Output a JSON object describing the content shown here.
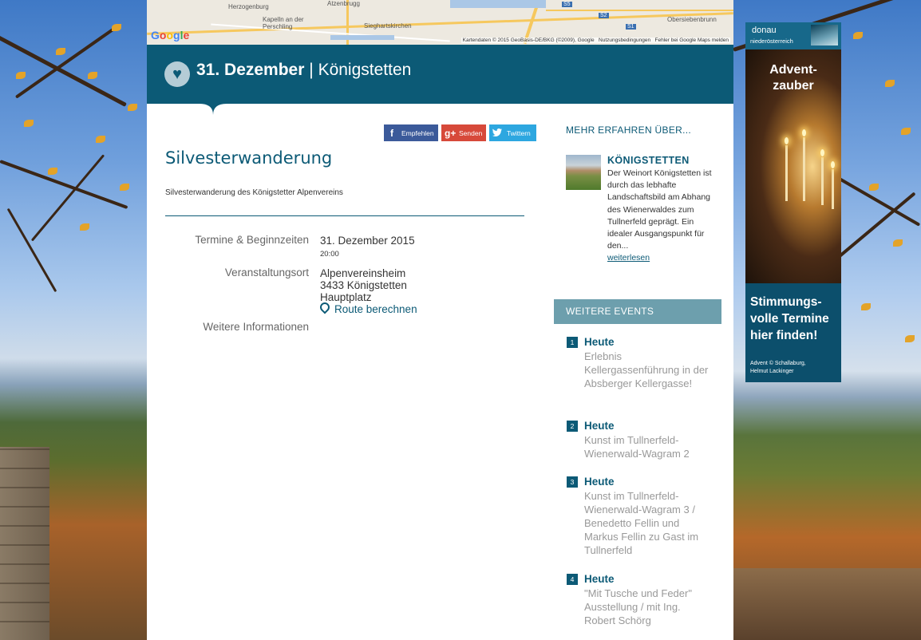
{
  "map": {
    "towns": [
      "Herzogenburg",
      "Atzenbrugg",
      "Kapelln an der Perschling",
      "Sieghartskirchen",
      "Obersiebenbrunn"
    ],
    "road_shields": [
      "S5",
      "S2",
      "S1"
    ],
    "logo": "Google",
    "attribution": "Kartendaten © 2015 GeoBasis-DE/BKG (©2009), Google",
    "terms": "Nutzungsbedingungen",
    "report": "Fehler bei Google Maps melden"
  },
  "header": {
    "date": "31. Dezember",
    "separator": "|",
    "place": "Königstetten",
    "favorite_icon": "heart-icon"
  },
  "share": {
    "facebook": "Empfehlen",
    "google": "Senden",
    "twitter": "Twittern"
  },
  "event": {
    "title": "Silvesterwanderung",
    "subtitle": "Silvesterwanderung des Königstetter Alpenvereins",
    "labels": {
      "dates": "Termine & Beginnzeiten",
      "venue": "Veranstaltungsort",
      "info": "Weitere Informationen"
    },
    "date": "31. Dezember 2015",
    "time": "20:00",
    "venue_name": "Alpenvereinsheim",
    "venue_zip_city": "3433 Königstetten",
    "venue_street": "Hauptplatz",
    "route_label": "Route berechnen"
  },
  "more": {
    "heading": "MEHR ERFAHREN ÜBER...",
    "place_title": "KÖNIGSTETTEN",
    "place_text": "Der Weinort Königstetten ist durch das lebhafte Landschaftsbild am Abhang des Wienerwaldes zum Tullnerfeld geprägt. Ein idealer Ausgangspunkt für den...",
    "read_more": "weiterlesen"
  },
  "further_events": {
    "heading": "WEITERE EVENTS",
    "items": [
      {
        "num": "1",
        "day": "Heute",
        "text": "Erlebnis Kellergassenführung in der Absberger Kellergasse!"
      },
      {
        "num": "2",
        "day": "Heute",
        "text": "Kunst im Tullnerfeld-Wienerwald-Wagram 2"
      },
      {
        "num": "3",
        "day": "Heute",
        "text": "Kunst im Tullnerfeld-Wienerwald-Wagram 3 / Benedetto Fellin und Markus Fellin zu Gast im Tullnerfeld"
      },
      {
        "num": "4",
        "day": "Heute",
        "text": "\"Mit Tusche und Feder\" Ausstellung / mit Ing. Robert Schörg"
      }
    ]
  },
  "ad": {
    "logo_word": "donau",
    "logo_sub": "niederösterreich",
    "headline": "Advent-\nzauber",
    "cta": "Stimmungs-\nvolle Termine\nhier finden!",
    "credit": "Advent © Schallaburg,\nHelmut Lackinger"
  },
  "colors": {
    "brand": "#0c5a76",
    "sidebar_header": "#6d9fad",
    "facebook": "#3b5a9a",
    "google": "#d7493a",
    "twitter": "#2da7e0"
  }
}
